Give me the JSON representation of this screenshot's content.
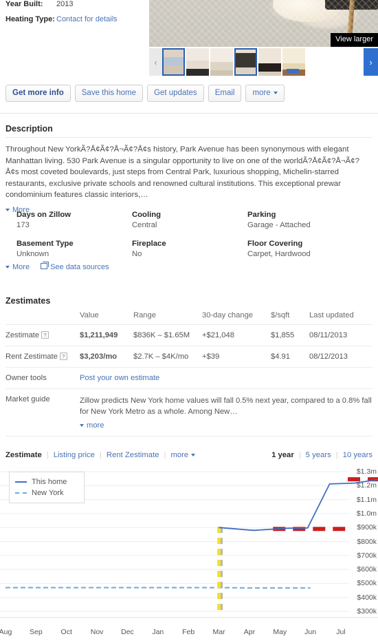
{
  "facts_top": [
    {
      "key": "Year Built:",
      "value": "2013",
      "is_link": false
    },
    {
      "key": "Heating Type:",
      "value": "Contact for details",
      "is_link": true
    }
  ],
  "photo": {
    "view_larger_label": "View larger",
    "prev_label": "‹",
    "next_label": "›",
    "thumbnails": [
      {
        "name": "thumb-bedroom",
        "selected": true
      },
      {
        "name": "thumb-kitchen",
        "selected": false
      },
      {
        "name": "thumb-living-room",
        "selected": false
      },
      {
        "name": "thumb-fireplace",
        "selected": true
      },
      {
        "name": "thumb-study",
        "selected": false
      },
      {
        "name": "thumb-kitchen-2",
        "selected": false
      }
    ]
  },
  "actions": [
    {
      "label": "Get more info",
      "primary": true,
      "caret": false
    },
    {
      "label": "Save this home",
      "primary": false,
      "caret": false
    },
    {
      "label": "Get updates",
      "primary": false,
      "caret": false
    },
    {
      "label": "Email",
      "primary": false,
      "caret": false
    },
    {
      "label": "more",
      "primary": false,
      "caret": true
    }
  ],
  "description": {
    "title": "Description",
    "body": "Throughout New YorkÃ?Å¢Ã¢?Å¬Ã¢?Å¢s history, Park Avenue has been synonymous with elegant Manhattan living. 530 Park Avenue is a singular opportunity to live on one of the worldÃ?Å¢Ã¢?Å¬Ã¢?Å¢s most coveted boulevards, just steps from Central Park, luxurious shopping, Michelin-starred restaurants, exclusive private schools and renowned cultural institutions. This exceptional prewar condominium features classic interiors,…",
    "more_label": "More"
  },
  "facts_grid": [
    {
      "name": "Days on Zillow",
      "value": "173"
    },
    {
      "name": "Cooling",
      "value": "Central"
    },
    {
      "name": "Parking",
      "value": "Garage - Attached"
    },
    {
      "name": "Basement Type",
      "value": "Unknown"
    },
    {
      "name": "Fireplace",
      "value": "No"
    },
    {
      "name": "Floor Covering",
      "value": "Carpet, Hardwood"
    }
  ],
  "facts_links": {
    "more_label": "More",
    "data_sources_label": "See data sources"
  },
  "zestimates": {
    "title": "Zestimates",
    "columns": [
      "",
      "Value",
      "Range",
      "30-day change",
      "$/sqft",
      "Last updated"
    ],
    "rows": [
      {
        "label": "Zestimate",
        "has_help": true,
        "value": "$1,211,949",
        "range": "$836K – $1.65M",
        "change": "+$21,048",
        "sqft": "$1,855",
        "updated": "08/11/2013"
      },
      {
        "label": "Rent Zestimate",
        "has_help": true,
        "value": "$3,203/mo",
        "range": "$2.7K – $4K/mo",
        "change": "+$39",
        "sqft": "$4.91",
        "updated": "08/12/2013"
      }
    ],
    "owner_tools": {
      "label": "Owner tools",
      "link": "Post your own estimate"
    },
    "market_guide": {
      "label": "Market guide",
      "text": "Zillow predicts New York home values will fall 0.5% next year, compared to a 0.8% fall for New York Metro as a whole. Among New…",
      "more_label": "more"
    }
  },
  "chart_header": {
    "tabs": [
      {
        "label": "Zestimate",
        "active": true
      },
      {
        "label": "Listing price",
        "active": false
      },
      {
        "label": "Rent Zestimate",
        "active": false
      },
      {
        "label": "more",
        "active": false,
        "caret": true
      }
    ],
    "ranges": [
      {
        "label": "1 year",
        "active": true
      },
      {
        "label": "5 years",
        "active": false
      },
      {
        "label": "10 years",
        "active": false
      }
    ]
  },
  "chart_data": {
    "type": "line",
    "title": "",
    "xlabel": "",
    "ylabel": "",
    "legend": [
      {
        "name": "This home",
        "color": "#3f6fc4",
        "style": "solid"
      },
      {
        "name": "New York",
        "color": "#6fa8dc",
        "style": "dashed"
      }
    ],
    "legend_position": "top-left",
    "grid": true,
    "ylim": [
      300000,
      1300000
    ],
    "ytick_labels": [
      "$1.3m",
      "$1.2m",
      "$1.1m",
      "$1.0m",
      "$900k",
      "$800k",
      "$700k",
      "$600k",
      "$500k",
      "$400k",
      "$300k"
    ],
    "ytick_values": [
      1300000,
      1200000,
      1100000,
      1000000,
      900000,
      800000,
      700000,
      600000,
      500000,
      400000,
      300000
    ],
    "categories": [
      "Aug",
      "Sep",
      "Oct",
      "Nov",
      "Dec",
      "Jan",
      "Feb",
      "Mar",
      "Apr",
      "May",
      "Jun",
      "Jul"
    ],
    "marker_line": {
      "at": "Mar",
      "colors": [
        "#f5e02a",
        "#9a9a9a"
      ],
      "style": "dashed-vertical"
    },
    "series": [
      {
        "name": "This home",
        "color": "#3f6fc4",
        "style": "solid",
        "x": [
          "Mar",
          "Apr",
          "May",
          "Jun",
          "Jun",
          "Jul",
          "Jul"
        ],
        "values": [
          900000,
          880000,
          895000,
          1210000,
          1215000,
          1235000,
          1240000
        ]
      },
      {
        "name": "New York",
        "color": "#6fa8dc",
        "style": "dashed",
        "x": [
          "Aug",
          "Sep",
          "Oct",
          "Nov",
          "Dec",
          "Jan",
          "Feb",
          "Mar",
          "Apr",
          "May",
          "Jun"
        ],
        "values": [
          470000,
          470000,
          470000,
          470000,
          470000,
          470000,
          470000,
          470000,
          468000,
          468000,
          468000
        ]
      },
      {
        "name": "Listing price",
        "color": "#cc1f1f",
        "style": "thick-dashed",
        "x": [
          "May",
          "Jun",
          "Jul"
        ],
        "values": [
          890000,
          890000,
          890000
        ]
      },
      {
        "name": "Listing price upper",
        "color": "#cc1f1f",
        "style": "thick-dashed",
        "x": [
          "Jul",
          "Jul"
        ],
        "values": [
          1245000,
          1245000
        ]
      }
    ]
  }
}
